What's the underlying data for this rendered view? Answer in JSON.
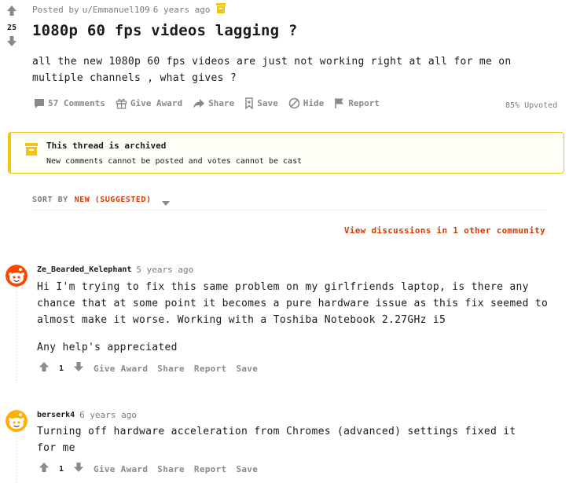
{
  "post": {
    "score": "25",
    "posted_by": "Posted by",
    "author": "u/Emmanuel109",
    "time": "6 years ago",
    "title": "1080p 60 fps videos lagging ?",
    "body": "all the new 1080p 60 fps videos are just not working right at all for me on multiple channels , what gives ?",
    "actions": {
      "comments": "57 Comments",
      "award": "Give Award",
      "share": "Share",
      "save": "Save",
      "hide": "Hide",
      "report": "Report"
    },
    "upvoted": "85% Upvoted"
  },
  "archived": {
    "title": "This thread is archived",
    "subtitle": "New comments cannot be posted and votes cannot be cast",
    "color": "#f0c419"
  },
  "sort": {
    "label": "SORT BY",
    "value": "NEW (SUGGESTED)"
  },
  "view_discussions": "View discussions in 1 other community",
  "comments": [
    {
      "author": "Ze_Bearded_Kelephant",
      "time": "5 years ago",
      "text": "Hi I'm trying to fix this same problem on my girlfriends laptop, is there any chance that at some point it becomes a pure hardware issue as this fix seemed to almost make it worse. Working with a Toshiba Notebook 2.27GHz i5",
      "text2": "Any help's appreciated",
      "score": "1",
      "actions": {
        "award": "Give Award",
        "share": "Share",
        "report": "Report",
        "save": "Save"
      },
      "avatar_color": "#ff4500"
    },
    {
      "author": "berserk4",
      "time": "6 years ago",
      "text": "Turning off hardware acceleration from Chromes (advanced) settings fixed it for me",
      "score": "1",
      "actions": {
        "award": "Give Award",
        "share": "Share",
        "report": "Report",
        "save": "Save"
      },
      "avatar_color": "#ffb000"
    }
  ]
}
